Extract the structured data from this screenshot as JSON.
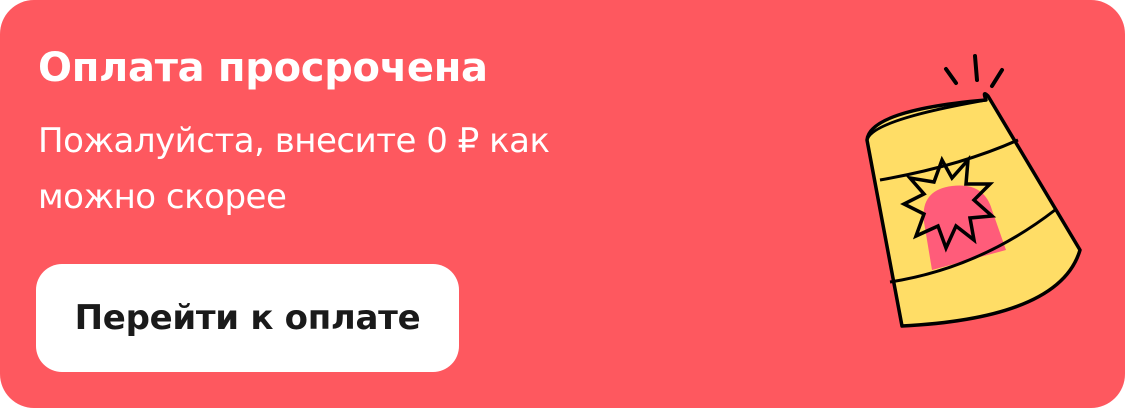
{
  "banner": {
    "background_color": "#fe585f",
    "title": "Оплата просрочена",
    "subtitle": "Пожалуйста, внесите 0 ₽ как можно скорее",
    "button": {
      "label": "Перейти к оплате",
      "background_color": "#ffffff",
      "text_color": "#1a1a1a"
    },
    "illustration": {
      "icon": "siren-alarm-icon",
      "body_color": "#ffdd66",
      "lamp_color": "#ff5c7a",
      "outline_color": "#000000"
    }
  }
}
